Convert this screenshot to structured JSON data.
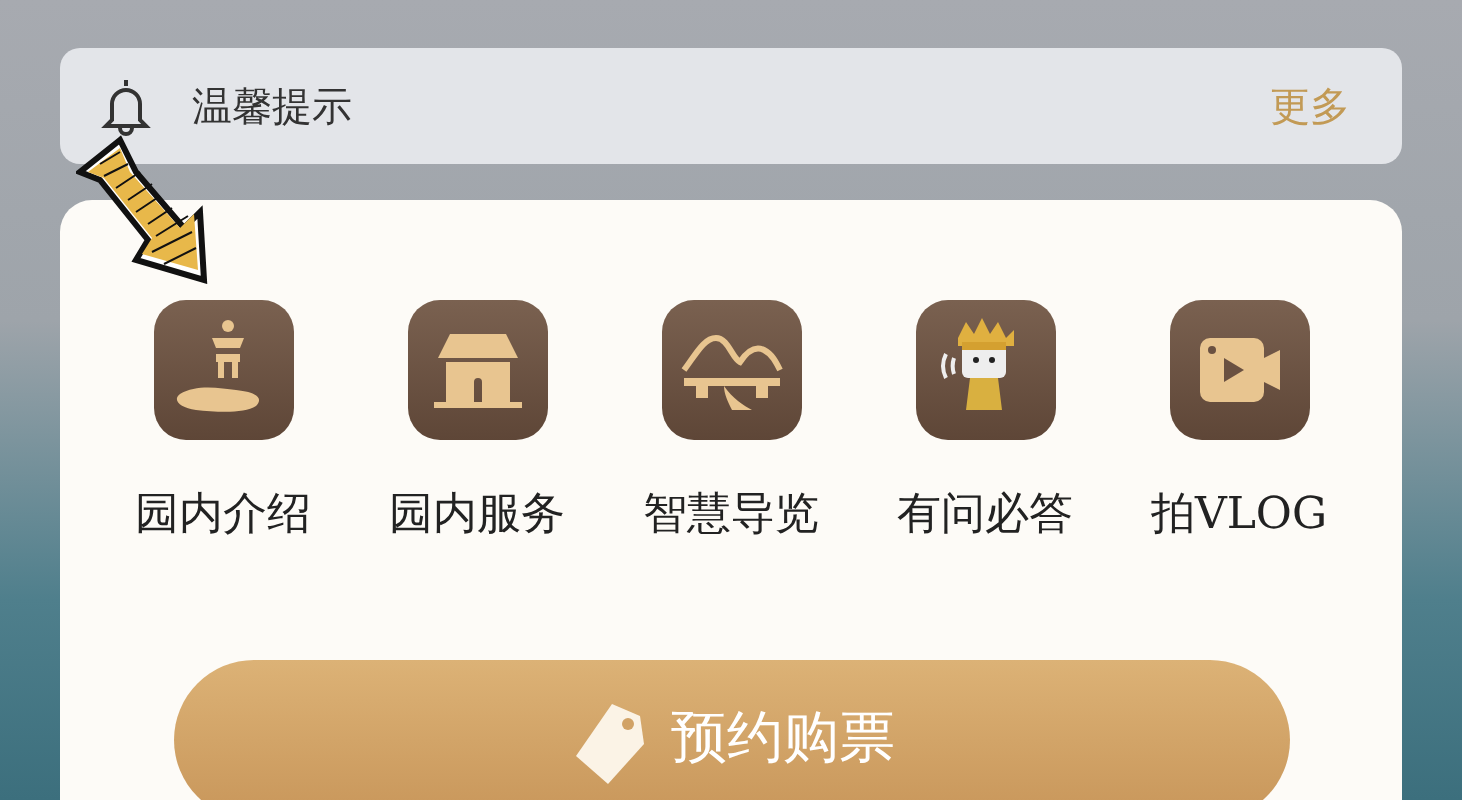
{
  "notice": {
    "title": "温馨提示",
    "more": "更多"
  },
  "services": [
    {
      "kind": "pagoda",
      "label": "园内介绍"
    },
    {
      "kind": "house",
      "label": "园内服务"
    },
    {
      "kind": "hills",
      "label": "智慧导览"
    },
    {
      "kind": "mascot",
      "label": "有问必答"
    },
    {
      "kind": "video",
      "label": "拍VLOG"
    }
  ],
  "booking_button": "预约购票"
}
